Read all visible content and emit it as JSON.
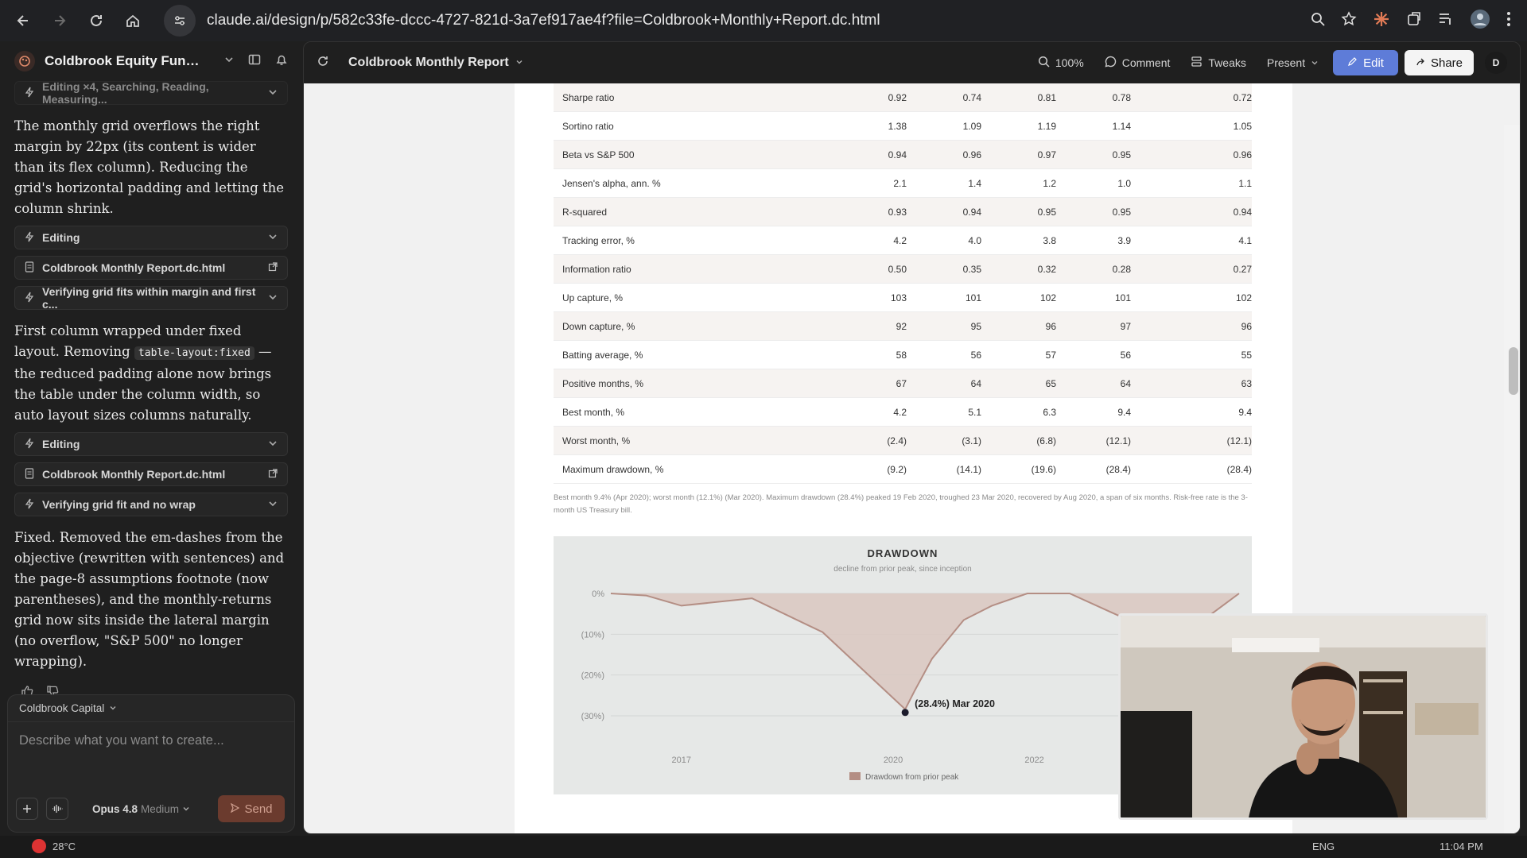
{
  "browser": {
    "url": "claude.ai/design/p/582c33fe-dccc-4727-821d-3a7ef917ae4f?file=Coldbrook+Monthly+Report.dc.html"
  },
  "sidebar": {
    "project_title": "Coldbrook Equity Fund Re...",
    "items": [
      {
        "type": "chip",
        "label": "Editing ×4, Searching, Reading, Measuring...",
        "faded": true
      },
      {
        "type": "msg",
        "text": "The monthly grid overflows the right margin by 22px (its content is wider than its flex column). Reducing the grid's horizontal padding and letting the column shrink."
      },
      {
        "type": "chip",
        "label": "Editing"
      },
      {
        "type": "file",
        "label": "Coldbrook Monthly Report.dc.html"
      },
      {
        "type": "chip",
        "label": "Verifying grid fits within margin and first c..."
      },
      {
        "type": "msg_code",
        "before": "First column wrapped under fixed layout. Removing ",
        "code": "table-layout:fixed",
        "after": " — the reduced padding alone now brings the table under the column width, so auto layout sizes columns naturally."
      },
      {
        "type": "chip",
        "label": "Editing"
      },
      {
        "type": "file",
        "label": "Coldbrook Monthly Report.dc.html"
      },
      {
        "type": "chip",
        "label": "Verifying grid fit and no wrap"
      },
      {
        "type": "msg",
        "text": "Fixed. Removed the em-dashes from the objective (rewritten with sentences) and the page-8 assumptions footnote (now parentheses), and the monthly-returns grid now sits inside the lateral margin (no overflow, \"S&P 500\" no longer wrapping)."
      }
    ],
    "composer": {
      "org": "Coldbrook Capital",
      "placeholder": "Describe what you want to create...",
      "model": "Opus 4.8",
      "effort": "Medium",
      "send": "Send"
    }
  },
  "toolbar": {
    "doc_title": "Coldbrook Monthly Report",
    "zoom": "100%",
    "comment": "Comment",
    "tweaks": "Tweaks",
    "present": "Present",
    "edit": "Edit",
    "share": "Share",
    "avatar": "D"
  },
  "metrics": [
    {
      "label": "Sharpe ratio",
      "v": [
        "0.92",
        "0.74",
        "0.81",
        "0.78",
        "0.72"
      ]
    },
    {
      "label": "Sortino ratio",
      "v": [
        "1.38",
        "1.09",
        "1.19",
        "1.14",
        "1.05"
      ]
    },
    {
      "label": "Beta vs S&P 500",
      "v": [
        "0.94",
        "0.96",
        "0.97",
        "0.95",
        "0.96"
      ]
    },
    {
      "label": "Jensen's alpha, ann. %",
      "v": [
        "2.1",
        "1.4",
        "1.2",
        "1.0",
        "1.1"
      ]
    },
    {
      "label": "R-squared",
      "v": [
        "0.93",
        "0.94",
        "0.95",
        "0.95",
        "0.94"
      ]
    },
    {
      "label": "Tracking error, %",
      "v": [
        "4.2",
        "4.0",
        "3.8",
        "3.9",
        "4.1"
      ]
    },
    {
      "label": "Information ratio",
      "v": [
        "0.50",
        "0.35",
        "0.32",
        "0.28",
        "0.27"
      ]
    },
    {
      "label": "Up capture, %",
      "v": [
        "103",
        "101",
        "102",
        "101",
        "102"
      ]
    },
    {
      "label": "Down capture, %",
      "v": [
        "92",
        "95",
        "96",
        "97",
        "96"
      ]
    },
    {
      "label": "Batting average, %",
      "v": [
        "58",
        "56",
        "57",
        "56",
        "55"
      ]
    },
    {
      "label": "Positive months, %",
      "v": [
        "67",
        "64",
        "65",
        "64",
        "63"
      ]
    },
    {
      "label": "Best month, %",
      "v": [
        "4.2",
        "5.1",
        "6.3",
        "9.4",
        "9.4"
      ]
    },
    {
      "label": "Worst month, %",
      "v": [
        "(2.4)",
        "(3.1)",
        "(6.8)",
        "(12.1)",
        "(12.1)"
      ]
    },
    {
      "label": "Maximum drawdown, %",
      "v": [
        "(9.2)",
        "(14.1)",
        "(19.6)",
        "(28.4)",
        "(28.4)"
      ]
    }
  ],
  "footnote": "Best month 9.4% (Apr 2020); worst month (12.1%) (Mar 2020). Maximum drawdown (28.4%) peaked 19 Feb 2020, troughed 23 Mar 2020, recovered by Aug 2020, a span of six months. Risk-free rate is the 3-month US Treasury bill.",
  "chart_data": {
    "type": "area",
    "title": "DRAWDOWN",
    "subtitle": "decline from prior peak, since inception",
    "x": [
      2016,
      2016.5,
      2017,
      2018,
      2019,
      2020.17,
      2020.3,
      2020.55,
      2021,
      2021.4,
      2021.9,
      2022.5,
      2023.2,
      2023.65,
      2024.2,
      2024.9
    ],
    "values": [
      0,
      -0.5,
      -3.0,
      -1.2,
      -9.5,
      -28.4,
      -24.0,
      -16.0,
      -6.5,
      -3.0,
      0,
      0,
      -5.5,
      -14.0,
      -9.0,
      0
    ],
    "ylim": [
      -30,
      0
    ],
    "yticks": [
      0,
      -10,
      -20,
      -30
    ],
    "ytick_labels": [
      "0%",
      "(10%)",
      "(20%)",
      "(30%)"
    ],
    "xtick_labels": [
      "2017",
      "2020",
      "2022"
    ],
    "annotation": {
      "x": 2020.17,
      "y": -28.4,
      "label": "(28.4%) Mar 2020"
    },
    "legend": "Drawdown from prior peak",
    "fill_color": "#d9c7c0",
    "line_color": "#b48e84"
  },
  "taskbar": {
    "weather": "28°C",
    "lang": "ENG",
    "time": "11:04 PM"
  }
}
